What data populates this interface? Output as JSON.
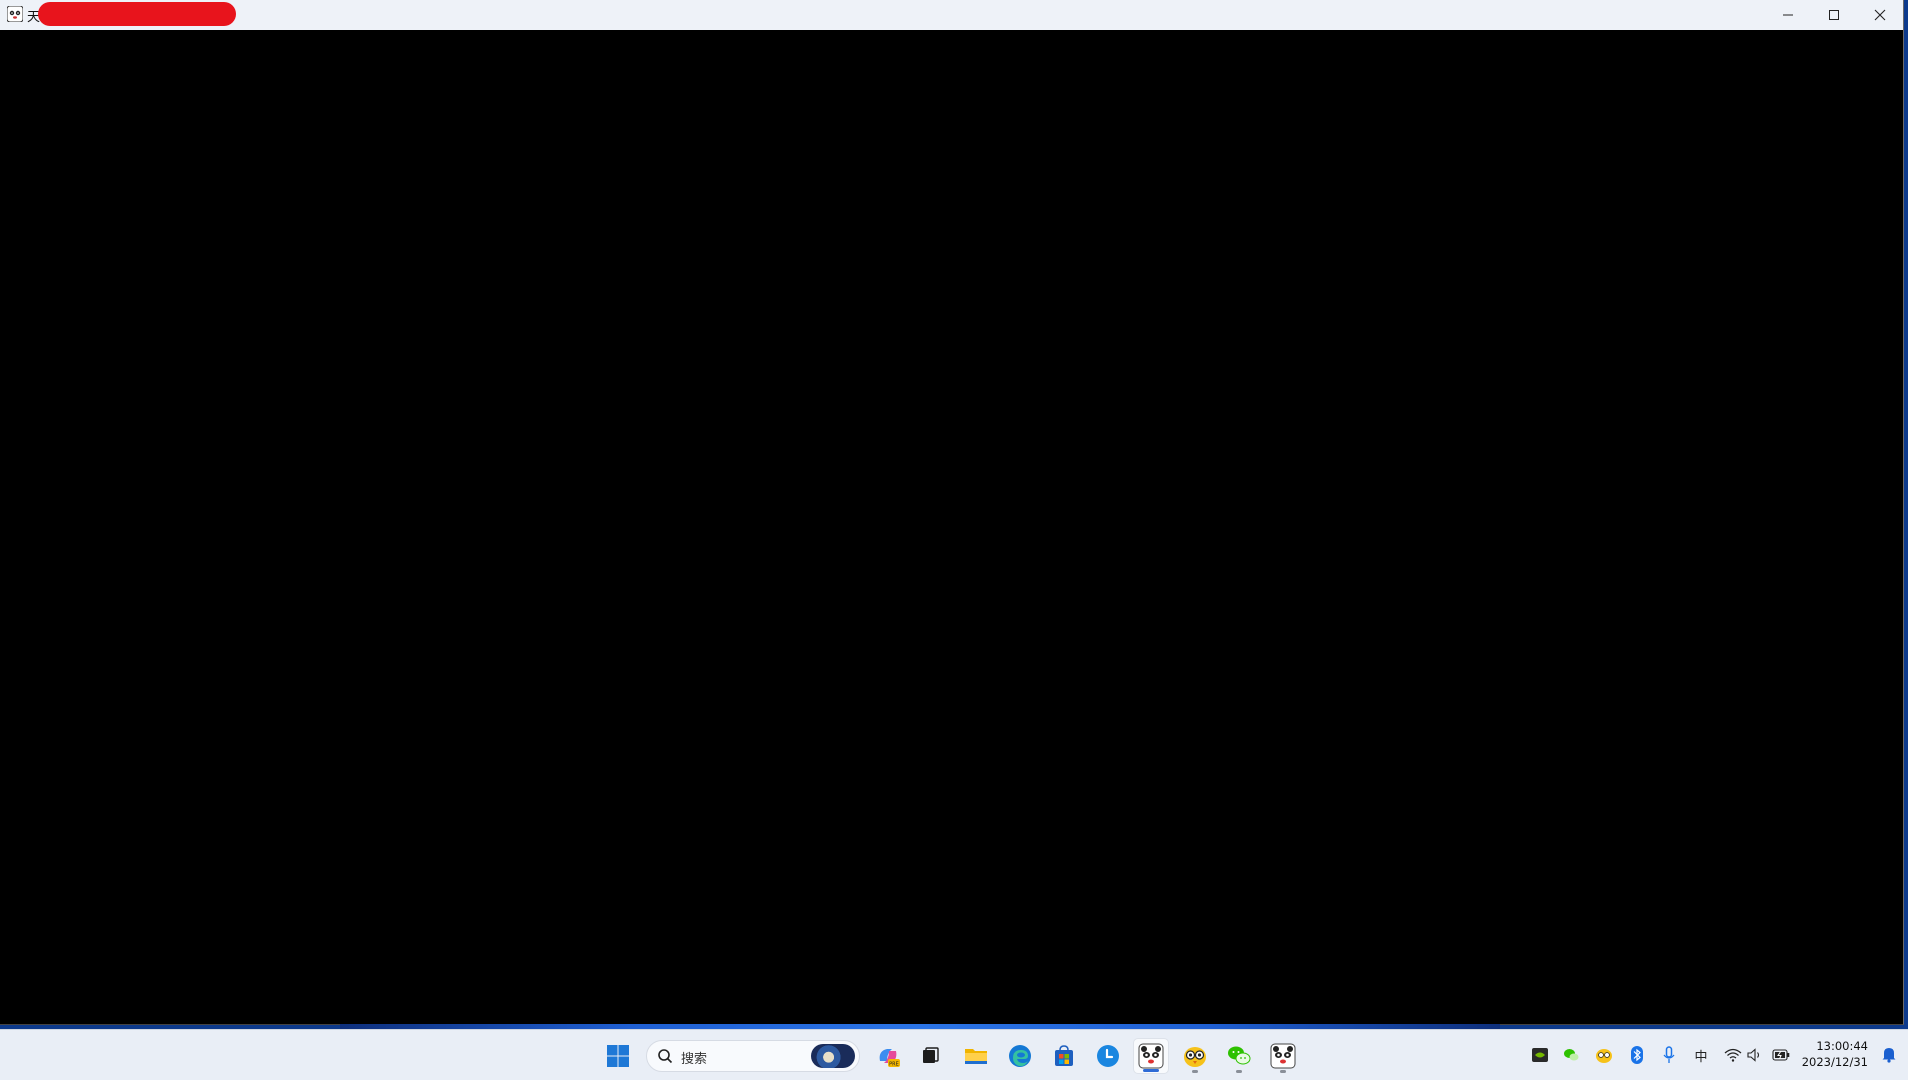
{
  "window": {
    "title_visible_char": "天",
    "buttons": {
      "minimize_icon": "minimize-icon",
      "maximize_icon": "maximize-icon",
      "close_icon": "close-icon"
    },
    "content_color": "#000000"
  },
  "taskbar": {
    "search_placeholder": "搜索",
    "apps": [
      {
        "name": "start-menu",
        "icon": "windows-logo-icon"
      },
      {
        "name": "copilot",
        "icon": "copilot-icon"
      },
      {
        "name": "task-view",
        "icon": "task-view-icon"
      },
      {
        "name": "file-explorer",
        "icon": "folder-icon"
      },
      {
        "name": "edge",
        "icon": "edge-icon"
      },
      {
        "name": "store",
        "icon": "store-icon"
      },
      {
        "name": "clock-app",
        "icon": "clock-icon"
      },
      {
        "name": "panda-app",
        "icon": "panda-icon"
      },
      {
        "name": "owl-app",
        "icon": "owl-icon"
      },
      {
        "name": "wechat",
        "icon": "wechat-icon"
      },
      {
        "name": "panda-app-2",
        "icon": "panda-icon"
      }
    ],
    "tray": {
      "ime": "中",
      "time": "13:00:44",
      "date": "2023/12/31"
    }
  },
  "colors": {
    "taskbar_bg": "#e9eef6",
    "titlebar_bg": "#eef2f8",
    "accent": "#2e6bd6",
    "redaction": "#e8141c"
  }
}
